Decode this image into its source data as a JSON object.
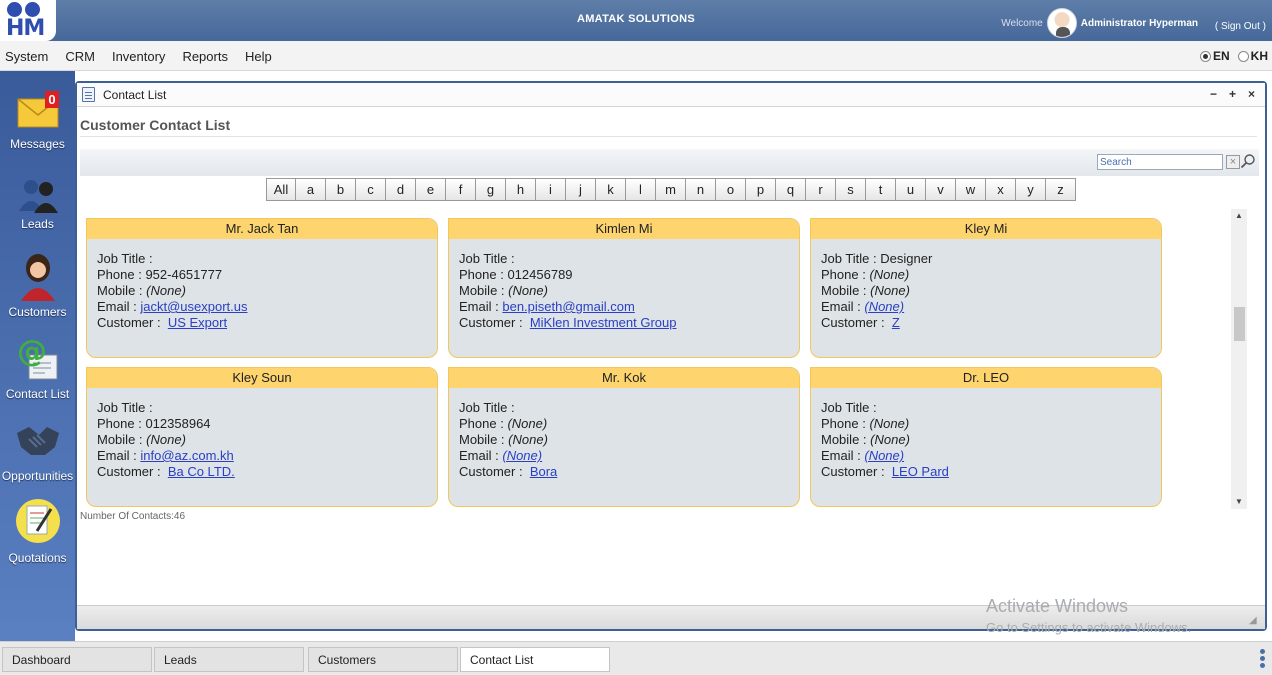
{
  "header": {
    "logo_text": "HM",
    "app_title": "AMATAK SOLUTIONS",
    "welcome_label": "Welcome",
    "user_name": "Administrator Hyperman",
    "sign_out": "( Sign Out )"
  },
  "menu": [
    "System",
    "CRM",
    "Inventory",
    "Reports",
    "Help"
  ],
  "language": {
    "options": [
      "EN",
      "KH"
    ],
    "selected": "EN"
  },
  "sidebar": [
    {
      "label": "Messages",
      "icon": "envelope-icon",
      "badge": "0"
    },
    {
      "label": "Leads",
      "icon": "people-icon"
    },
    {
      "label": "Customers",
      "icon": "customer-icon"
    },
    {
      "label": "Contact List",
      "icon": "contact-card-icon"
    },
    {
      "label": "Opportunities",
      "icon": "handshake-icon"
    },
    {
      "label": "Quotations",
      "icon": "quotation-icon"
    }
  ],
  "window": {
    "title": "Contact List",
    "section_title": "Customer Contact List",
    "search_placeholder": "Search",
    "clear_symbol": "×",
    "alphabet": [
      "All",
      "a",
      "b",
      "c",
      "d",
      "e",
      "f",
      "g",
      "h",
      "i",
      "j",
      "k",
      "l",
      "m",
      "n",
      "o",
      "p",
      "q",
      "r",
      "s",
      "t",
      "u",
      "v",
      "w",
      "x",
      "y",
      "z"
    ],
    "labels": {
      "job_title": "Job Title :",
      "phone": "Phone :",
      "mobile": "Mobile :",
      "email": "Email :",
      "customer": "Customer :"
    },
    "contacts": [
      {
        "name": "Mr. Jack Tan",
        "job_title": "",
        "phone": "952-4651777",
        "mobile": "(None)",
        "email": "jackt@usexport.us",
        "customer": "US Export"
      },
      {
        "name": "Kimlen Mi",
        "job_title": "",
        "phone": "012456789",
        "mobile": "(None)",
        "email": "ben.piseth@gmail.com",
        "customer": "MiKlen Investment Group"
      },
      {
        "name": "Kley Mi",
        "job_title": "Designer",
        "phone": "(None)",
        "mobile": "(None)",
        "email": "(None)",
        "customer": "Z"
      },
      {
        "name": "Kley Soun",
        "job_title": "",
        "phone": "012358964",
        "mobile": "(None)",
        "email": "info@az.com.kh",
        "customer": "Ba Co LTD."
      },
      {
        "name": "Mr. Kok",
        "job_title": "",
        "phone": "(None)",
        "mobile": "(None)",
        "email": "(None)",
        "customer": "Bora"
      },
      {
        "name": "Dr. LEO",
        "job_title": "",
        "phone": "(None)",
        "mobile": "(None)",
        "email": "(None)",
        "customer": "LEO Pard"
      }
    ],
    "count_text": "Number Of Contacts:46"
  },
  "watermark": {
    "line1": "Activate Windows",
    "line2": "Go to Settings to activate Windows."
  },
  "taskbar": {
    "tabs": [
      "Dashboard",
      "Leads",
      "Customers",
      "Contact List"
    ],
    "active": "Contact List"
  }
}
